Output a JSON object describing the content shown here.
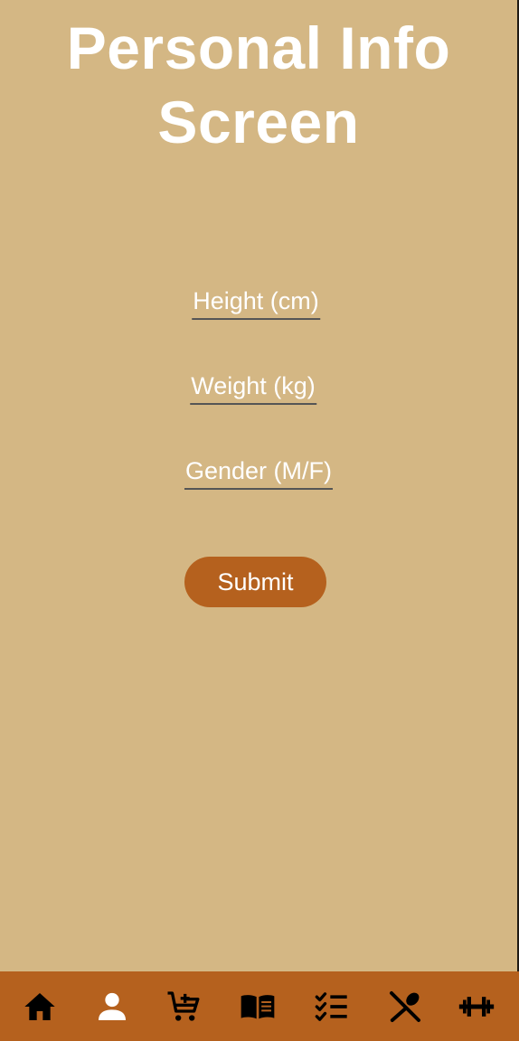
{
  "screen": {
    "title": "Personal Info Screen",
    "background_color": "#d4b784"
  },
  "form": {
    "height_placeholder": "Height (cm)",
    "weight_placeholder": "Weight (kg)",
    "gender_placeholder": "Gender (M/F)",
    "submit_label": "Submit",
    "accent_color": "#b5611e"
  },
  "navbar": {
    "background_color": "#b5611e",
    "items": [
      {
        "icon": "home-icon",
        "active": false
      },
      {
        "icon": "person-icon",
        "active": true
      },
      {
        "icon": "cart-add-icon",
        "active": false
      },
      {
        "icon": "book-icon",
        "active": false
      },
      {
        "icon": "checklist-icon",
        "active": false
      },
      {
        "icon": "utensils-icon",
        "active": false
      },
      {
        "icon": "dumbbell-icon",
        "active": false
      }
    ]
  }
}
